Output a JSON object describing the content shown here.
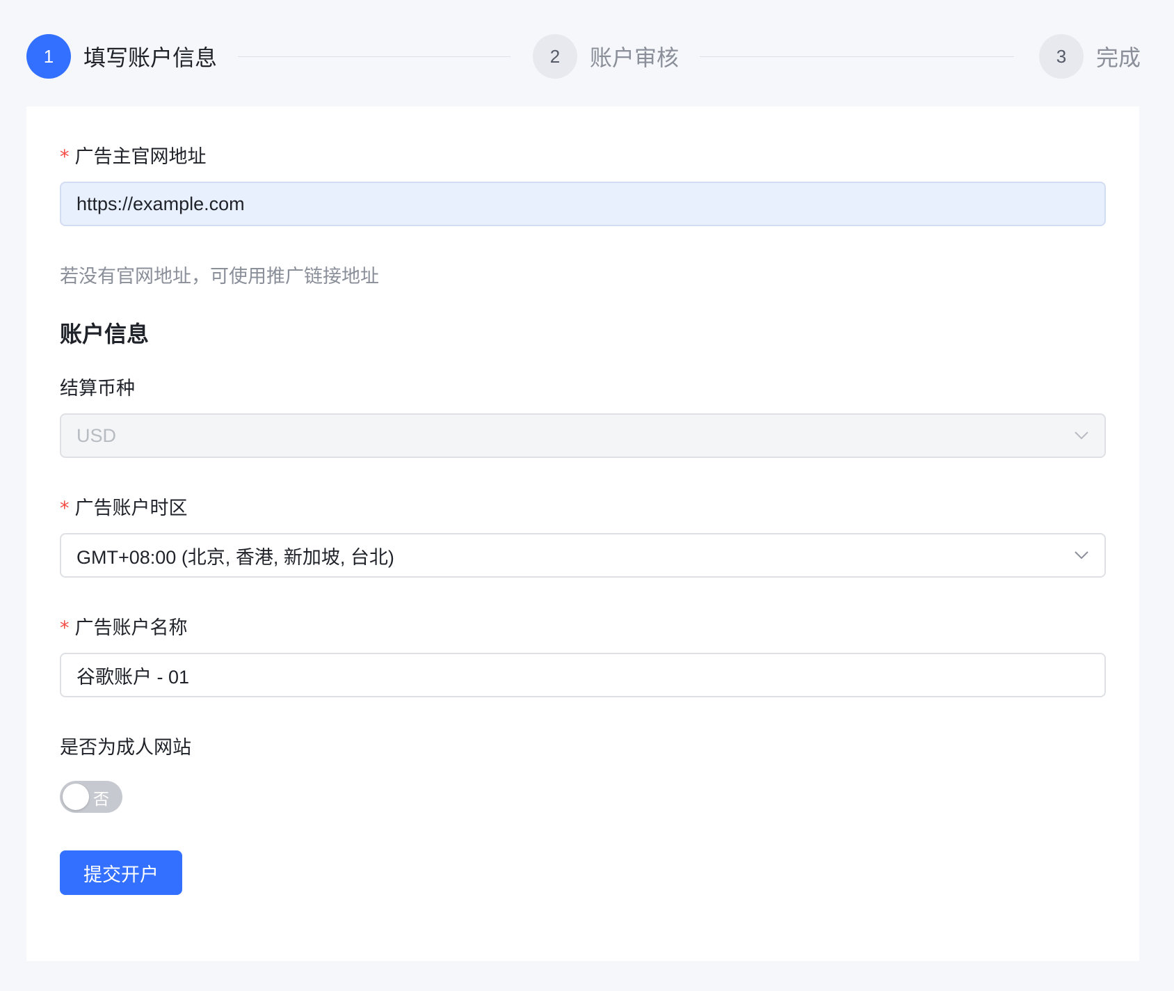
{
  "steps": [
    {
      "number": "1",
      "label": "填写账户信息",
      "state": "active"
    },
    {
      "number": "2",
      "label": "账户审核",
      "state": "inactive"
    },
    {
      "number": "3",
      "label": "完成",
      "state": "inactive"
    }
  ],
  "form": {
    "required_mark": "*",
    "website": {
      "label": "广告主官网地址",
      "value": "https://example.com",
      "hint": "若没有官网地址，可使用推广链接地址"
    },
    "section_title": "账户信息",
    "currency": {
      "label": "结算币种",
      "value": "USD"
    },
    "timezone": {
      "label": "广告账户时区",
      "value": "GMT+08:00 (北京, 香港, 新加坡, 台北)"
    },
    "account_name": {
      "label": "广告账户名称",
      "value": "谷歌账户 - 01"
    },
    "adult_site": {
      "label": "是否为成人网站",
      "switch_text": "否",
      "checked": false
    },
    "submit_label": "提交开户"
  },
  "colors": {
    "primary": "#3370ff",
    "required": "#f54a45",
    "page_bg": "#f6f7fb"
  },
  "icons": {
    "dropdown": "chevron-down-icon"
  }
}
